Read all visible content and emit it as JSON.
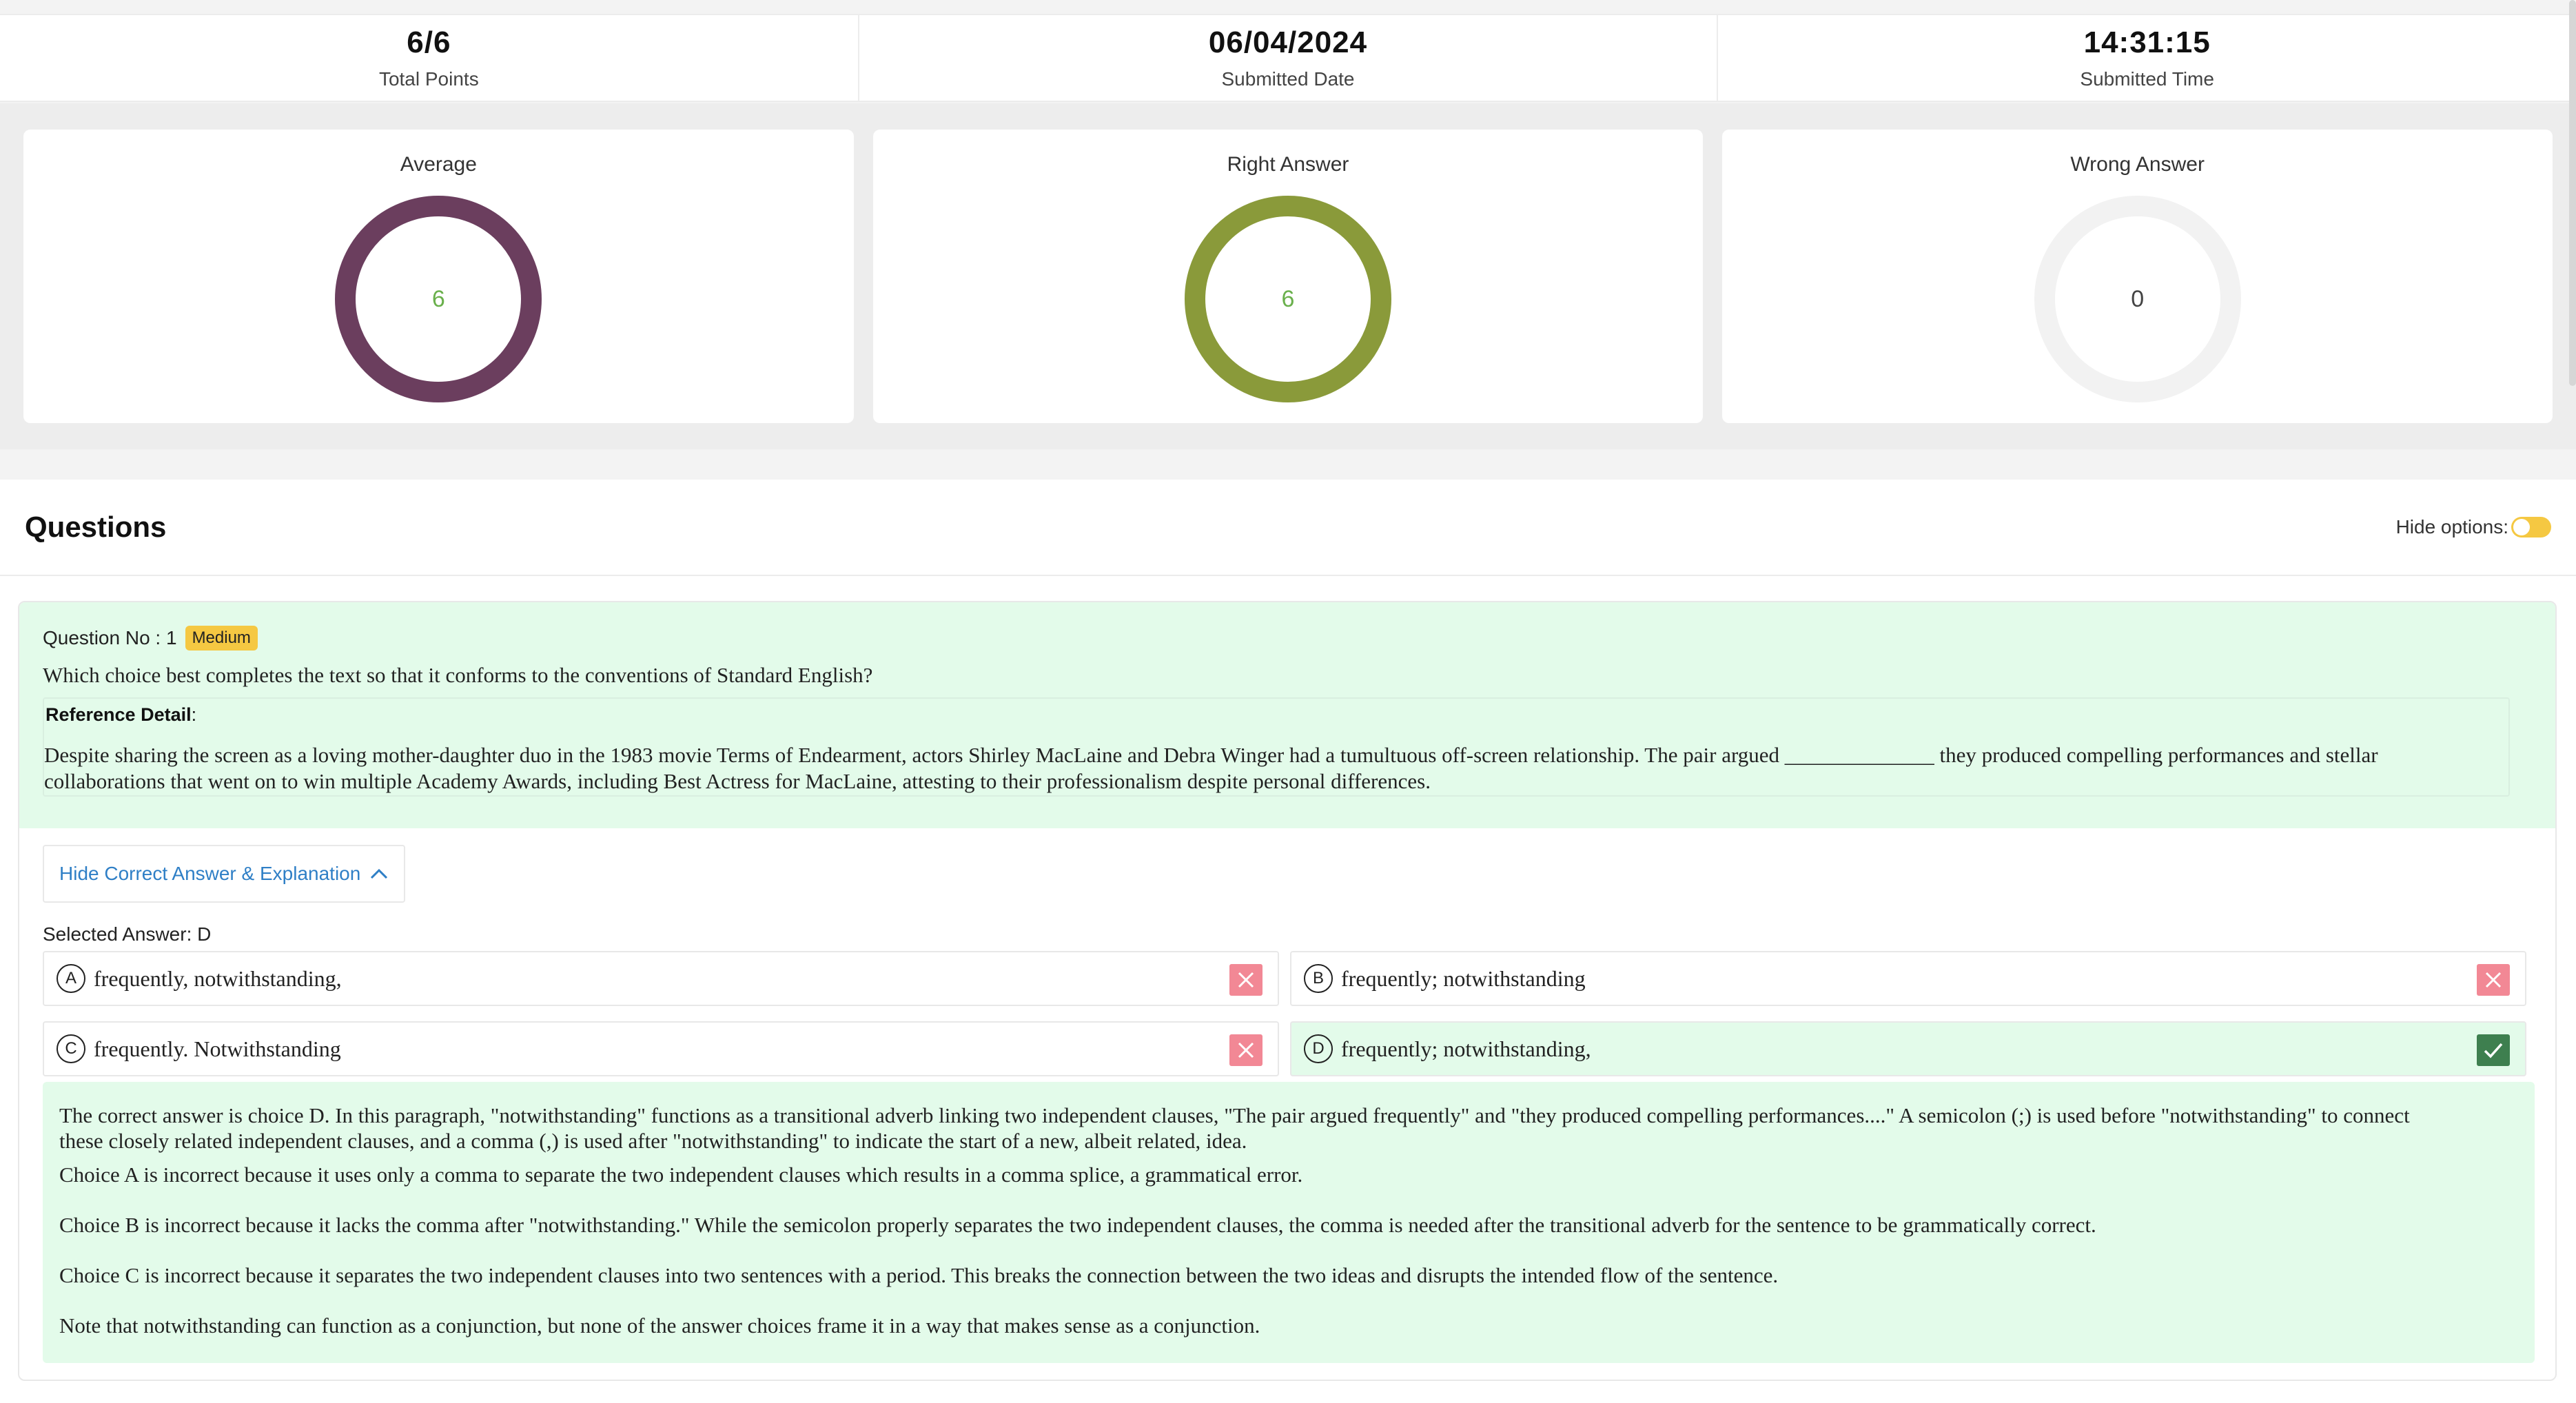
{
  "stats": [
    {
      "value": "6/6",
      "label": "Total Points"
    },
    {
      "value": "06/04/2024",
      "label": "Submitted Date"
    },
    {
      "value": "14:31:15",
      "label": "Submitted Time"
    }
  ],
  "charts": [
    {
      "title": "Average",
      "value": "6",
      "ring_color": "#6b3e5e",
      "value_color": "#6ab04c",
      "fill_fraction": 1.0
    },
    {
      "title": "Right Answer",
      "value": "6",
      "ring_color": "#8a9a3a",
      "value_color": "#6ab04c",
      "fill_fraction": 1.0
    },
    {
      "title": "Wrong Answer",
      "value": "0",
      "ring_color": "#f2f2f2",
      "value_color": "#444444",
      "fill_fraction": 0.0
    }
  ],
  "questions": {
    "title": "Questions",
    "hide_options_label": "Hide options:",
    "hide_options_on": false
  },
  "question": {
    "number_label": "Question No : 1",
    "difficulty": "Medium",
    "text": "Which choice best completes the text so that it conforms to the conventions of Standard English?",
    "reference_label": "Reference Detail",
    "reference_colon": ":",
    "reference_line1": "Despite sharing the screen as a loving mother-daughter duo in the 1983 movie Terms of Endearment, actors Shirley MacLaine and Debra Winger had a tumultuous off-screen relationship. The pair argued ______________ they produced compelling performances and stellar",
    "reference_line2": "collaborations that went on to win multiple Academy Awards, including Best Actress for MacLaine, attesting to their professionalism despite personal differences.",
    "toggle_button": "Hide Correct Answer & Explanation",
    "selected_answer": "Selected Answer: D",
    "options": [
      {
        "letter": "A",
        "text": "frequently, notwithstanding,",
        "status": "wrong"
      },
      {
        "letter": "B",
        "text": "frequently; notwithstanding",
        "status": "wrong"
      },
      {
        "letter": "C",
        "text": "frequently. Notwithstanding",
        "status": "wrong"
      },
      {
        "letter": "D",
        "text": "frequently; notwithstanding,",
        "status": "correct"
      }
    ],
    "explanation": {
      "line1": "The correct answer is choice D. In this paragraph, \"notwithstanding\" functions as a transitional adverb linking two independent clauses, \"The pair argued frequently\" and \"they produced compelling performances....\" A semicolon (;) is used before \"notwithstanding\" to connect",
      "line2": "these closely related independent clauses, and a comma (,) is used after \"notwithstanding\" to indicate the start of a new, albeit related, idea.",
      "choice_a": "Choice A is incorrect because it uses only a comma to separate the two independent clauses which results in a comma splice, a grammatical error.",
      "choice_b": "Choice B is incorrect because it lacks the comma after \"notwithstanding.\" While the semicolon properly separates the two independent clauses, the comma is needed after the transitional adverb for the sentence to be grammatically correct.",
      "choice_c": "Choice C is incorrect because it separates the two independent clauses into two sentences with a period. This breaks the connection between the two ideas and disrupts the intended flow of the sentence.",
      "note": "Note that notwithstanding can function as a conjunction, but none of the answer choices frame it in a way that makes sense as a conjunction."
    }
  }
}
